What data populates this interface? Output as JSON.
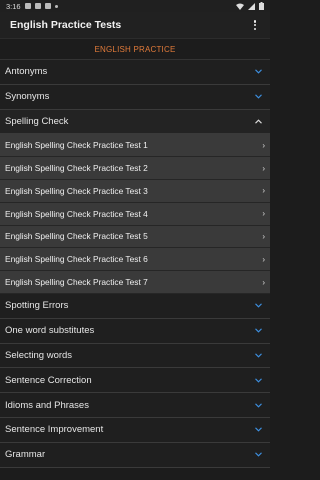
{
  "status_bar": {
    "time": "3:16"
  },
  "app_bar": {
    "title": "English Practice Tests"
  },
  "section": {
    "header": "ENGLISH PRACTICE"
  },
  "categories_before": [
    {
      "label": "Antonyms",
      "icon": "chevron-down-icon"
    },
    {
      "label": "Synonyms",
      "icon": "chevron-down-icon"
    }
  ],
  "expanded_category": {
    "label": "Spelling Check",
    "icon": "chevron-up-icon"
  },
  "sub_items": [
    {
      "label": "English Spelling Check Practice Test 1"
    },
    {
      "label": "English Spelling Check Practice Test 2"
    },
    {
      "label": "English Spelling Check Practice Test 3"
    },
    {
      "label": "English Spelling Check Practice Test 4"
    },
    {
      "label": "English Spelling Check Practice Test 5"
    },
    {
      "label": "English Spelling Check Practice Test 6"
    },
    {
      "label": "English Spelling Check Practice Test 7"
    }
  ],
  "categories_after": [
    {
      "label": "Spotting Errors"
    },
    {
      "label": "One word substitutes"
    },
    {
      "label": "Selecting words"
    },
    {
      "label": "Sentence Correction"
    },
    {
      "label": "Idioms and Phrases"
    },
    {
      "label": "Sentence Improvement"
    },
    {
      "label": "Grammar"
    }
  ],
  "colors": {
    "accent": "#e07a3a",
    "chevron": "#3d8fe0",
    "sub_bg": "#3a3a3a"
  }
}
